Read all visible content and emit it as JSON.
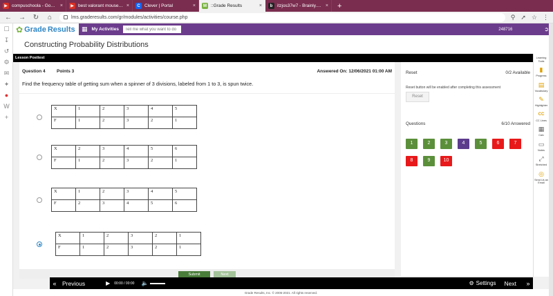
{
  "browser": {
    "tabs": [
      {
        "title": "compuschoola - Google Se",
        "favicon_color": "#d93025",
        "favicon": "▶",
        "active": false
      },
      {
        "title": "best valorant mouse - Goo",
        "favicon_color": "#d93025",
        "favicon": "▶",
        "active": false
      },
      {
        "title": "Clever | Portal",
        "favicon_color": "#1464f4",
        "favicon": "C",
        "active": false
      },
      {
        "title": "::Grade Results",
        "favicon_color": "#7bb342",
        "favicon": "M",
        "active": true
      },
      {
        "title": "itzjos37w7 - Brainly.com",
        "favicon_color": "#222222",
        "favicon": "b",
        "active": false
      }
    ],
    "new_tab": "+",
    "url": "lms.graderesults.com/gr/modules/activities/course.php"
  },
  "header": {
    "logo_grade": "Grade",
    "logo_results": "Results",
    "my_activities": "My Activities",
    "search_placeholder": "Tell me what you want to do",
    "account_id": "248716"
  },
  "page": {
    "title": "Constructing Probability Distributions",
    "lesson_label": "Lesson Posttest"
  },
  "question": {
    "number": "Question 4",
    "points": "Points 3",
    "answered": "Answered On: 12/06/2021 01:00 AM",
    "text": "Find the frequency table of getting sum when a spinner of 3 divisions, labeled from 1 to 3, is spun twice.",
    "options": [
      {
        "x_row": [
          "X",
          "1",
          "2",
          "3",
          "4",
          "5"
        ],
        "f_row": [
          "F",
          "1",
          "2",
          "3",
          "2",
          "1"
        ],
        "selected": false
      },
      {
        "x_row": [
          "X",
          "2",
          "3",
          "4",
          "5",
          "6"
        ],
        "f_row": [
          "F",
          "1",
          "2",
          "3",
          "2",
          "1"
        ],
        "selected": false
      },
      {
        "x_row": [
          "X",
          "1",
          "2",
          "3",
          "4",
          "5"
        ],
        "f_row": [
          "F",
          "2",
          "3",
          "4",
          "5",
          "6"
        ],
        "selected": false
      },
      {
        "x_row": [
          "X",
          "1",
          "2",
          "3",
          "2",
          "1"
        ],
        "f_row": [
          "F",
          "1",
          "2",
          "3",
          "2",
          "1"
        ],
        "selected": true
      }
    ],
    "submit_label": "Submit",
    "next_label": "Next"
  },
  "right_panel": {
    "reset_title": "Reset",
    "reset_available": "0/2 Available",
    "reset_note": "Reset button will be enabled after completing this assessment",
    "reset_button": "Reset",
    "questions_title": "Questions",
    "questions_answered": "6/10 Answered",
    "questions": [
      {
        "label": "1",
        "color": "#5b8f3a"
      },
      {
        "label": "2",
        "color": "#5b8f3a"
      },
      {
        "label": "3",
        "color": "#5b8f3a"
      },
      {
        "label": "4",
        "color": "#5c3a8c"
      },
      {
        "label": "5",
        "color": "#5b8f3a"
      },
      {
        "label": "6",
        "color": "#e8191a"
      },
      {
        "label": "7",
        "color": "#e8191a"
      },
      {
        "label": "8",
        "color": "#e8191a"
      },
      {
        "label": "9",
        "color": "#5b8f3a"
      },
      {
        "label": "10",
        "color": "#e8191a"
      }
    ]
  },
  "tools": [
    {
      "label": "Learning Tools",
      "icon": "tools-icon"
    },
    {
      "label": "Progress",
      "icon": "progress-icon"
    },
    {
      "label": "Vocabulary",
      "icon": "vocabulary-icon"
    },
    {
      "label": "Highlighter",
      "icon": "highlighter-icon"
    },
    {
      "label": "CC Lines",
      "icon": "cc-icon"
    },
    {
      "label": "Calc",
      "icon": "calculator-icon"
    },
    {
      "label": "Notes",
      "icon": "notes-icon"
    },
    {
      "label": "Stretched",
      "icon": "stretch-icon"
    },
    {
      "label": "Send Us an Email",
      "icon": "email-icon"
    }
  ],
  "media": {
    "prev": "Previous",
    "time_current": "00:00",
    "time_sep": "/",
    "time_total": "00:00",
    "settings": "Settings",
    "next": "Next"
  },
  "footer": "Grade Results, Inc. © 2005-2021. All rights reserved."
}
